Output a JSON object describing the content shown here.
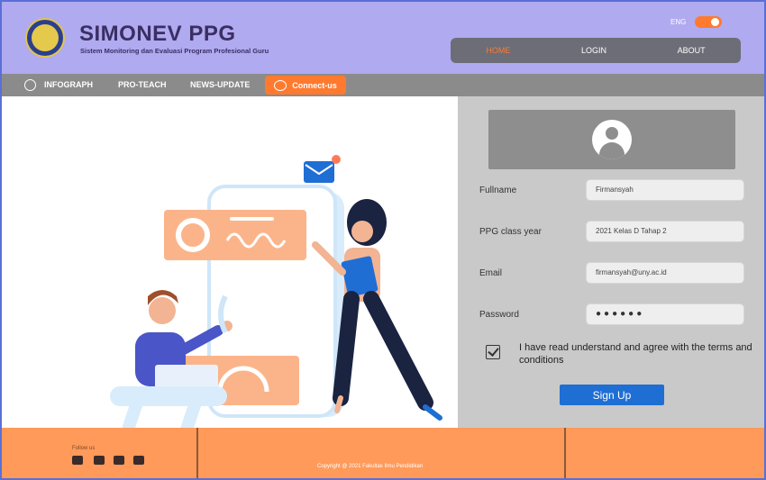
{
  "app": {
    "title": "SIMONEV PPG",
    "subtitle": "Sistem Monitoring dan Evaluasi Program Profesional Guru"
  },
  "language": {
    "label": "ENG"
  },
  "topnav": {
    "items": [
      "HOME",
      "LOGIN",
      "ABOUT"
    ],
    "active": "HOME"
  },
  "subnav": {
    "items": [
      "INFOGRAPH",
      "PRO-TEACH",
      "NEWS-UPDATE"
    ],
    "connect_label": "Connect-us"
  },
  "form": {
    "fields": [
      {
        "label": "Fullname",
        "value": "Firmansyah"
      },
      {
        "label": "PPG class year",
        "value": "2021 Kelas D Tahap 2"
      },
      {
        "label": "Email",
        "value": "firmansyah@uny.ac.id"
      },
      {
        "label": "Password",
        "value": "●●●●●●"
      }
    ],
    "terms": "I have read understand and agree with the terms and conditions",
    "signup_label": "Sign Up"
  },
  "footer": {
    "follow_label": "Follow us",
    "social_icons": [
      "youtube-icon",
      "twitter-icon",
      "instagram-icon",
      "facebook-icon"
    ],
    "copyright": "Copyright @ 2021 Fakultas Ilmu Pendidikan"
  },
  "colors": {
    "header": "#b0aaf0",
    "accent": "#ff7a2f",
    "footer": "#ff9a5a",
    "button": "#1f6ed4"
  }
}
